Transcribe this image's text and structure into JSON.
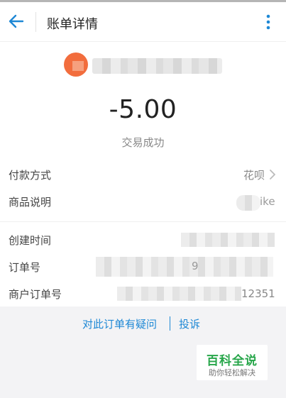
{
  "header": {
    "title": "账单详情",
    "back_icon": "arrow-left-icon",
    "more_icon": "more-vertical-icon"
  },
  "transaction": {
    "amount": "-5.00",
    "status": "交易成功"
  },
  "details": {
    "payment_method": {
      "label": "付款方式",
      "value": "花呗"
    },
    "product_desc": {
      "label": "商品说明",
      "value_visible": "ike"
    },
    "created_time": {
      "label": "创建时间"
    },
    "order_no": {
      "label": "订单号",
      "value_visible": "9"
    },
    "merchant_order_no": {
      "label": "商户订单号",
      "value_visible": "12351"
    }
  },
  "actions": {
    "question_label": "对此订单有疑问",
    "complain_label": "投诉"
  },
  "watermark": {
    "title": "百科全说",
    "subtitle": "助你轻松解决"
  },
  "colors": {
    "accent": "#1e88d5",
    "avatar": "#f26d3d",
    "watermark": "#27a64a"
  }
}
